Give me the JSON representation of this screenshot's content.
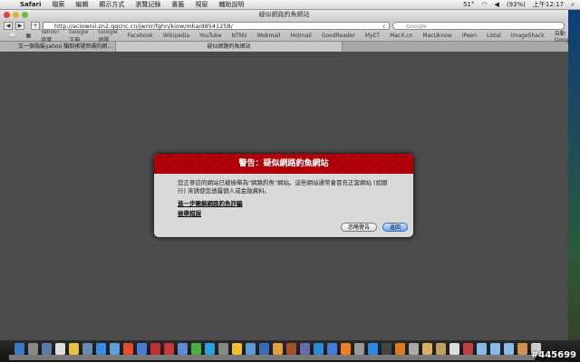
{
  "menubar": {
    "apple": "",
    "app": "Safari",
    "items": [
      "檔案",
      "編輯",
      "顯示方式",
      "瀏覽記錄",
      "書籤",
      "視窗",
      "輔助說明"
    ],
    "temp": "51°",
    "battery": "(93%)",
    "clock": "上午12:17"
  },
  "window": {
    "title": "疑似網路釣魚網站",
    "url": "http://aciownii.zn2.qqcnc.cn/jwnir/fghn/kiow/mka/d8541258/",
    "search_placeholder": "Google",
    "reload": "c"
  },
  "bookmarks": [
    "Yahoo!奇摩",
    "Google 字典",
    "Google 地圖",
    "Facebook",
    "Wikipedia",
    "YouTube",
    "NTNU",
    "Webmail",
    "Hotmail",
    "GoodReader",
    "MyET",
    "MacX.cn",
    "MacUknow",
    "iPeen",
    "Listal",
    "ImageShack",
    "自動Google"
  ],
  "tabs": [
    {
      "label": "又一個偽裝yahoo 騙取帳號密碼的網..."
    },
    {
      "label": "疑似網路釣魚網站"
    }
  ],
  "dialog": {
    "title": "警告：疑似網路釣魚網站",
    "message": "您正參訪的網站已被檢舉為\"網路釣魚\"網站。這些網站通常會冒充正當網站 (如銀行) 來誘使您透露個人或金融資料。",
    "link_learn": "進一步瞭解網路釣魚詐騙",
    "link_report": "檢舉錯誤",
    "ignore_button": "忽略警告",
    "back_button": "返回"
  },
  "dock": {
    "colors": [
      "#3a78c8",
      "#888",
      "#5a7aa8",
      "#ddd",
      "#e8c040",
      "#6a8ab0",
      "#3a8ae8",
      "#5aa0d8",
      "#e84a2a",
      "#4a7ad8",
      "#c03030",
      "#c83a3a",
      "#5a8ad8",
      "#4ab040",
      "#2aa0e0",
      "#888",
      "#f0c030",
      "#5a9ad8",
      "#3a6ab8",
      "#e0a040",
      "#a0522d",
      "#6a6aa8",
      "#2a8ad8",
      "#4a7ad8",
      "#f08020",
      "#999",
      "#2a8ae0",
      "#444",
      "#e07a20",
      "#aaa",
      "#d8b060",
      "#c0a060",
      "#ddd",
      "#c04040",
      "#8ab8e8",
      "#8ab8e8",
      "#8ab8e8",
      "#d09050",
      "#ccc"
    ],
    "watermark": "#445699"
  }
}
